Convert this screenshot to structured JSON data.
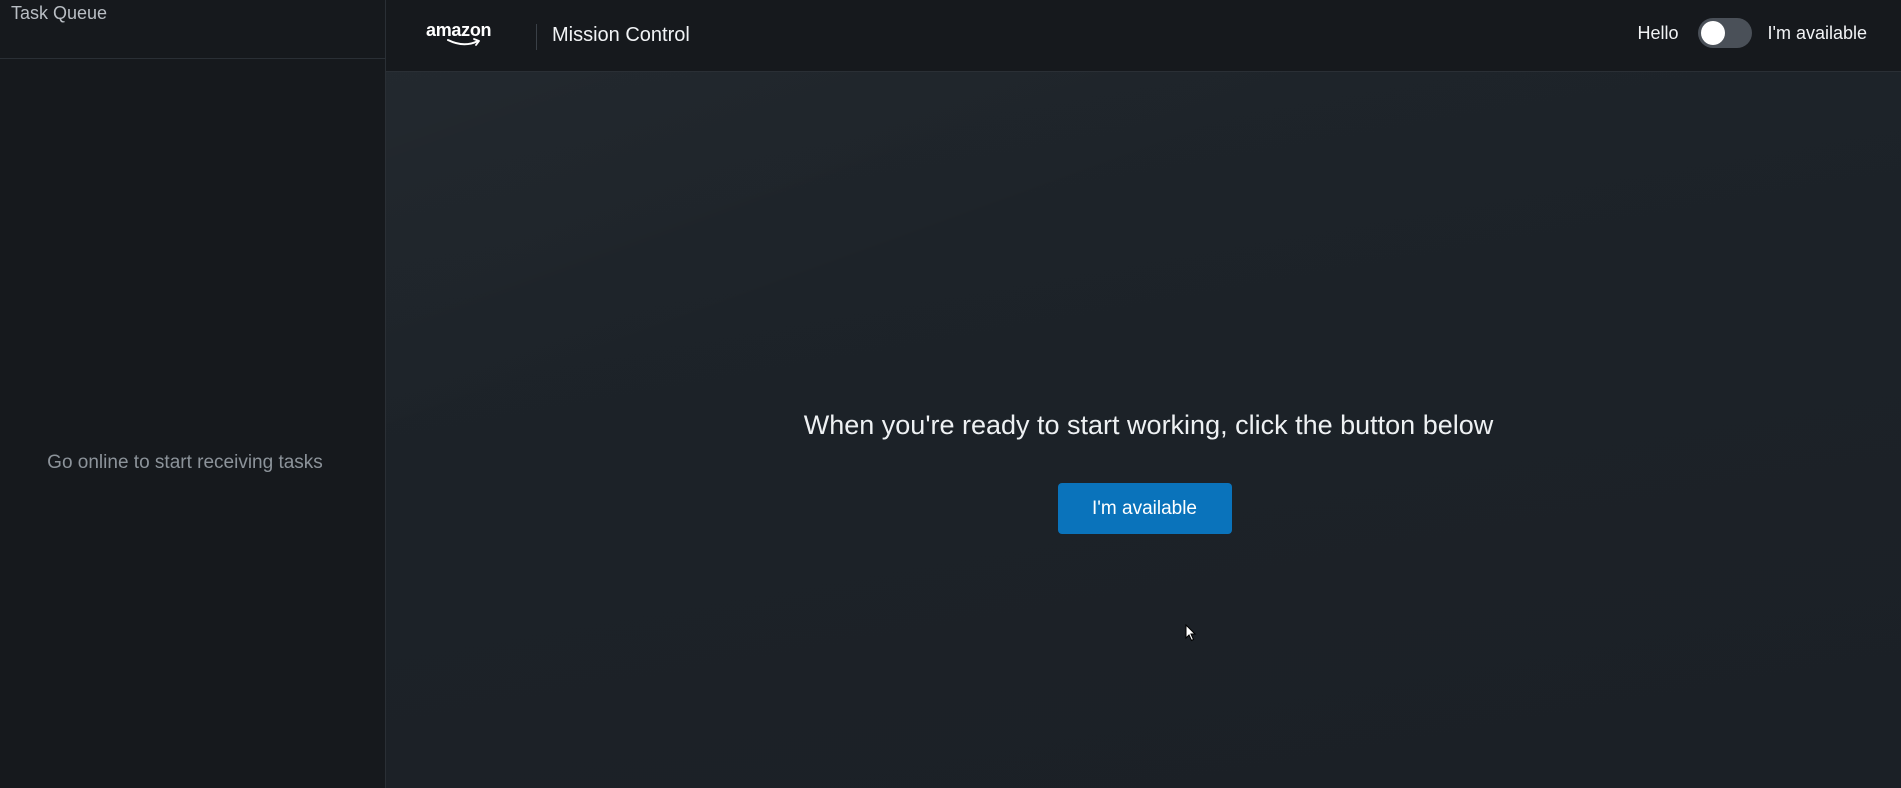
{
  "sidebar": {
    "title": "Task Queue",
    "empty_message": "Go online to start receiving tasks"
  },
  "header": {
    "brand": "amazon",
    "app_title": "Mission Control",
    "greeting": "Hello",
    "availability_toggle": {
      "on": false,
      "label": "I'm available"
    }
  },
  "main": {
    "message": "When you're ready to start working, click the button below",
    "button_label": "I'm available"
  },
  "colors": {
    "accent": "#0a73bb",
    "background": "#1b2127",
    "sidebar": "#16191d"
  }
}
